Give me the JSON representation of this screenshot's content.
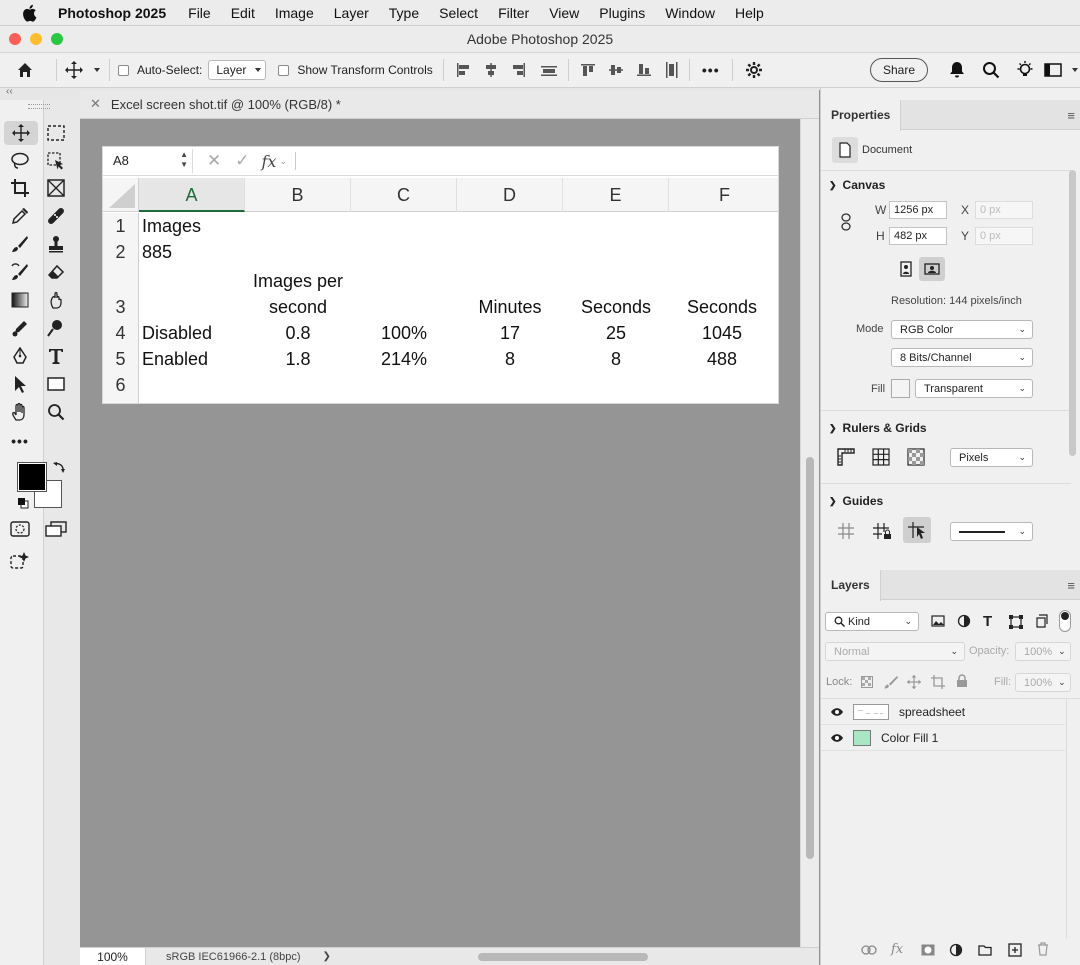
{
  "menubar": {
    "app_name": "Photoshop 2025",
    "items": [
      "File",
      "Edit",
      "Image",
      "Layer",
      "Type",
      "Select",
      "Filter",
      "View",
      "Plugins",
      "Window",
      "Help"
    ]
  },
  "window": {
    "title": "Adobe Photoshop 2025"
  },
  "options_bar": {
    "auto_select_label": "Auto-Select:",
    "auto_select_value": "Layer",
    "show_transform_label": "Show Transform Controls",
    "more_label": "•••",
    "share_label": "Share"
  },
  "document": {
    "tab_title": "Excel screen shot.tif @ 100% (RGB/8) *",
    "zoom": "100%",
    "color_profile": "sRGB IEC61966-2.1 (8bpc)",
    "status_arrow": "❯"
  },
  "spreadsheet": {
    "name_box": "A8",
    "fx_label": "fx",
    "columns": [
      "A",
      "B",
      "C",
      "D",
      "E",
      "F"
    ],
    "row_numbers": [
      "1",
      "2",
      "3",
      "4",
      "5",
      "6"
    ],
    "row1": {
      "a": "Images"
    },
    "row2": {
      "a": "885"
    },
    "row3": {
      "b_line1": "Images per",
      "b_line2": "second",
      "d": "Minutes",
      "e": "Seconds",
      "f": "Seconds"
    },
    "row4": {
      "a": "Disabled",
      "b": "0.8",
      "c": "100%",
      "d": "17",
      "e": "25",
      "f": "1045"
    },
    "row5": {
      "a": "Enabled",
      "b": "1.8",
      "c": "214%",
      "d": "8",
      "e": "8",
      "f": "488"
    }
  },
  "properties": {
    "tab": "Properties",
    "doc_label": "Document",
    "canvas": {
      "title": "Canvas",
      "w_label": "W",
      "w_value": "1256 px",
      "h_label": "H",
      "h_value": "482 px",
      "x_label": "X",
      "x_placeholder": "0 px",
      "y_label": "Y",
      "y_placeholder": "0 px",
      "resolution": "Resolution: 144 pixels/inch",
      "mode_label": "Mode",
      "mode_value": "RGB Color",
      "bits_value": "8 Bits/Channel",
      "fill_label": "Fill",
      "fill_value": "Transparent"
    },
    "rulers": {
      "title": "Rulers & Grids",
      "units": "Pixels"
    },
    "guides": {
      "title": "Guides"
    }
  },
  "layers": {
    "tab": "Layers",
    "kind_label": "Kind",
    "blend_mode": "Normal",
    "opacity_label": "Opacity:",
    "opacity_value": "100%",
    "lock_label": "Lock:",
    "fill_label": "Fill:",
    "fill_value": "100%",
    "items": [
      {
        "name": "spreadsheet"
      },
      {
        "name": "Color Fill 1"
      }
    ]
  },
  "colors": {
    "foreground": "#000000",
    "background": "#ffffff",
    "color_fill_swatch": "#a8e6c4",
    "excel_green": "#1f6b3a"
  }
}
